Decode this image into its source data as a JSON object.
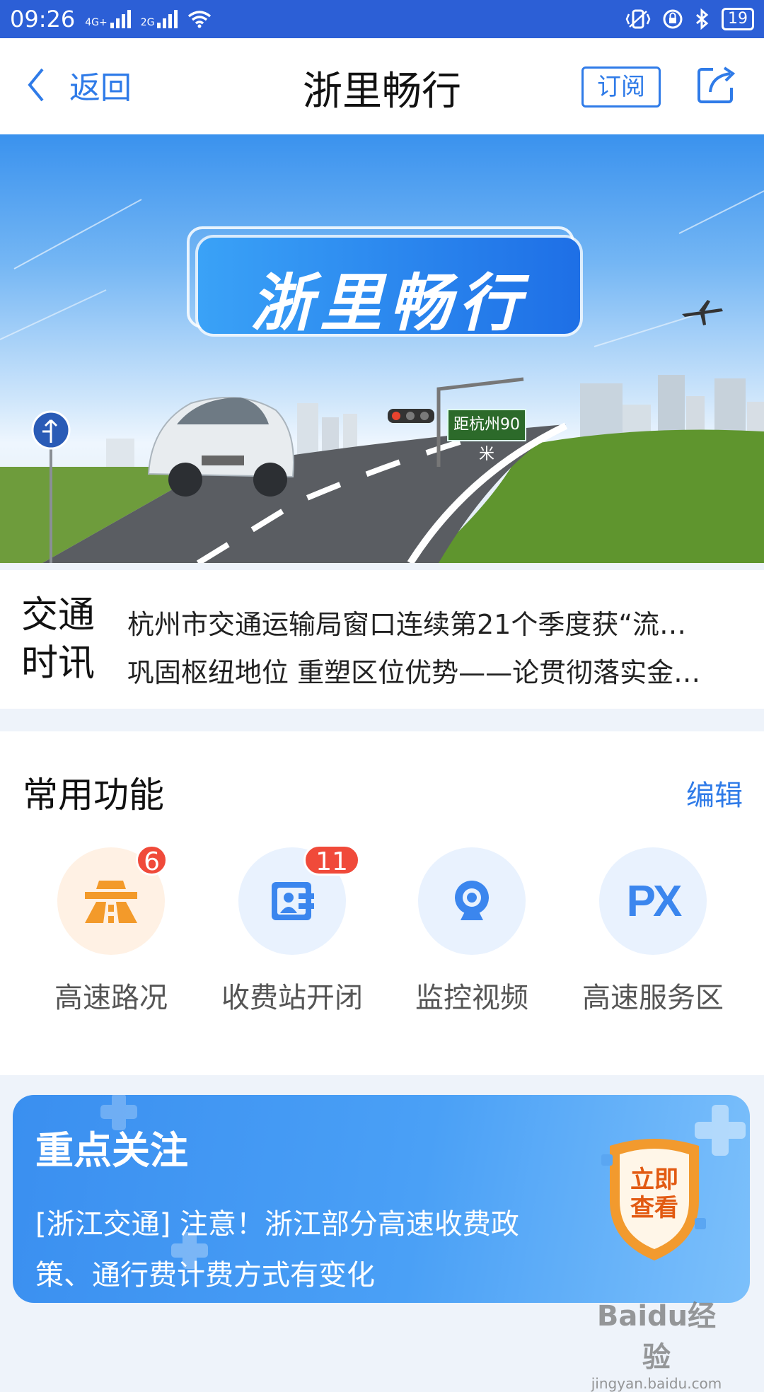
{
  "status_bar": {
    "time": "09:26",
    "net1": "4G+",
    "net2": "2G",
    "battery": "19"
  },
  "nav": {
    "back_label": "返回",
    "title": "浙里畅行",
    "subscribe_label": "订阅"
  },
  "banner": {
    "logo_text": "浙里畅行",
    "sign_text": "距杭州90米"
  },
  "news": {
    "label_line1": "交通",
    "label_line2": "时讯",
    "items": [
      "杭州市交通运输局窗口连续第21个季度获“流…",
      "巩固枢纽地位 重塑区位优势——论贯彻落实金…"
    ]
  },
  "functions": {
    "title": "常用功能",
    "edit_label": "编辑",
    "items": [
      {
        "label": "高速路况",
        "badge": "6",
        "icon": "highway-icon",
        "bg": "#fff1e4"
      },
      {
        "label": "收费站开闭",
        "badge": "11",
        "icon": "toll-station-icon",
        "bg": "#e9f2fe"
      },
      {
        "label": "监控视频",
        "badge": "",
        "icon": "camera-icon",
        "bg": "#e9f2fe"
      },
      {
        "label": "高速服务区",
        "badge": "",
        "icon": "service-area-icon",
        "bg": "#e9f2fe"
      }
    ],
    "px_icon_text": "PX"
  },
  "focus": {
    "title": "重点关注",
    "line1": "[浙江交通] 注意！浙江部分高速收费政",
    "line2": "策、通行费计费方式有变化",
    "cta_line1": "立即",
    "cta_line2": "查看"
  },
  "watermark": {
    "logo": "Baidu经验",
    "url": "jingyan.baidu.com"
  },
  "colors": {
    "status_bar": "#2c5fd6",
    "accent": "#2f7be8",
    "badge_red": "#f04a3a",
    "cta_orange": "#f29a2e"
  }
}
